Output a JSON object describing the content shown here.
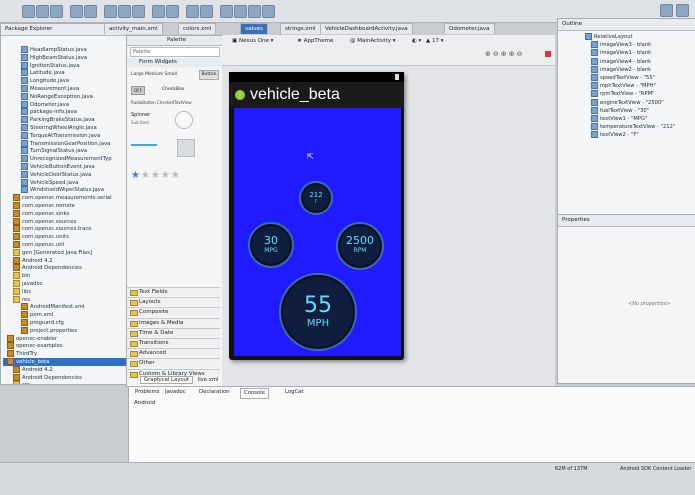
{
  "editor_tabs": [
    {
      "label": "activity_main.xml",
      "active": false
    },
    {
      "label": "colors.xml",
      "active": false
    },
    {
      "label": "values",
      "active": true
    },
    {
      "label": "strings.xml",
      "active": false
    },
    {
      "label": "VehicleDashboardActivity.java",
      "active": false
    },
    {
      "label": "Odometer.java",
      "active": false
    }
  ],
  "explorer": {
    "title": "Package Explorer",
    "items": [
      {
        "label": "HeadlampStatus.java",
        "icon": "java-file-icon"
      },
      {
        "label": "HighBeamStatus.java",
        "icon": "java-file-icon"
      },
      {
        "label": "IgnitionStatus.java",
        "icon": "java-file-icon"
      },
      {
        "label": "Latitude.java",
        "icon": "java-file-icon"
      },
      {
        "label": "Longitude.java",
        "icon": "java-file-icon"
      },
      {
        "label": "Measurement.java",
        "icon": "java-file-icon"
      },
      {
        "label": "NoRangeException.java",
        "icon": "java-file-icon"
      },
      {
        "label": "Odometer.java",
        "icon": "java-file-icon"
      },
      {
        "label": "package-info.java",
        "icon": "java-file-icon"
      },
      {
        "label": "ParkingBrakeStatus.java",
        "icon": "java-file-icon"
      },
      {
        "label": "SteeringWheelAngle.java",
        "icon": "java-file-icon"
      },
      {
        "label": "TorqueAtTransmission.java",
        "icon": "java-file-icon"
      },
      {
        "label": "TransmissionGearPosition.java",
        "icon": "java-file-icon"
      },
      {
        "label": "TurnSignalStatus.java",
        "icon": "java-file-icon"
      },
      {
        "label": "UnrecognizedMeasurementTyp",
        "icon": "java-file-icon"
      },
      {
        "label": "VehicleButtonEvent.java",
        "icon": "java-file-icon"
      },
      {
        "label": "VehicleDoorStatus.java",
        "icon": "java-file-icon"
      },
      {
        "label": "VehicleSpeed.java",
        "icon": "java-file-icon"
      },
      {
        "label": "WindshieldWiperStatus.java",
        "icon": "java-file-icon"
      },
      {
        "label": "com.openxc.measurements.serial",
        "icon": "package-icon"
      },
      {
        "label": "com.openxc.remote",
        "icon": "package-icon"
      },
      {
        "label": "com.openxc.sinks",
        "icon": "package-icon"
      },
      {
        "label": "com.openxc.sources",
        "icon": "package-icon"
      },
      {
        "label": "com.openxc.sources.trace",
        "icon": "package-icon"
      },
      {
        "label": "com.openxc.units",
        "icon": "package-icon"
      },
      {
        "label": "com.openxc.util",
        "icon": "package-icon"
      },
      {
        "label": "gen [Generated Java Files]",
        "icon": "folder-icon"
      },
      {
        "label": "Android 4.2",
        "icon": "library-icon"
      },
      {
        "label": "Android Dependencies",
        "icon": "library-icon"
      },
      {
        "label": "bin",
        "icon": "folder-icon"
      },
      {
        "label": "javadoc",
        "icon": "folder-icon"
      },
      {
        "label": "libs",
        "icon": "folder-icon"
      },
      {
        "label": "res",
        "icon": "folder-icon"
      },
      {
        "label": "AndroidManifest.xml",
        "icon": "xml-file-icon"
      },
      {
        "label": "pom.xml",
        "icon": "xml-file-icon"
      },
      {
        "label": "proguard.cfg",
        "icon": "file-icon"
      },
      {
        "label": "project.properties",
        "icon": "file-icon"
      },
      {
        "label": "openxc-enabler",
        "icon": "project-icon"
      },
      {
        "label": "openxc-examples",
        "icon": "project-icon"
      },
      {
        "label": "ThirdTry",
        "icon": "project-icon"
      },
      {
        "label": "vehicle_beta",
        "icon": "project-icon",
        "selected": true
      },
      {
        "label": "Android 4.2",
        "icon": "library-icon"
      },
      {
        "label": "Android Dependencies",
        "icon": "library-icon"
      },
      {
        "label": "src",
        "icon": "folder-icon"
      },
      {
        "label": "gen [Generated Java Files]",
        "icon": "folder-icon"
      },
      {
        "label": "assets",
        "icon": "folder-icon"
      },
      {
        "label": "bin",
        "icon": "folder-icon"
      },
      {
        "label": "libs",
        "icon": "folder-icon"
      },
      {
        "label": "res",
        "icon": "folder-icon"
      },
      {
        "label": "AndroidManifest.xml",
        "icon": "xml-file-icon"
      },
      {
        "label": "ic_launcher-web.png",
        "icon": "image-file-icon"
      },
      {
        "label": "proguard-project.txt",
        "icon": "file-icon"
      }
    ]
  },
  "palette": {
    "title": "Palette",
    "search": "Palette",
    "open_section": "Form Widgets",
    "widget_labels": {
      "text_sizes": "Large  Medium  Small",
      "button": "Button",
      "toggle_off": "OFF",
      "checkbox": "CheckBox",
      "radio": "RadioButton  CheckedTextView",
      "spinner": "Spinner",
      "spinner_sub": "Sub Item"
    },
    "sections": [
      "Text Fields",
      "Layouts",
      "Composite",
      "Images & Media",
      "Time & Date",
      "Transitions",
      "Advanced",
      "Other",
      "Custom & Library Views"
    ]
  },
  "layout_toolbar": {
    "device": "Nexus One",
    "theme": "AppTheme",
    "activity": "MainActivity",
    "api": "17"
  },
  "app_preview": {
    "title": "vehicle_beta",
    "temperature": "212",
    "temperature_unit": "F",
    "fuel": "30",
    "fuel_unit": "MPG",
    "rpm": "2500",
    "rpm_unit": "RPM",
    "speed": "55",
    "speed_unit": "MPH",
    "bg_color": "#1f1aff"
  },
  "editor_bottom_tabs": [
    "Graphical Layout",
    "live.xml"
  ],
  "outline": {
    "title": "Outline",
    "items": [
      {
        "label": "RelativeLayout",
        "depth": 0
      },
      {
        "label": "imageView3 - blank",
        "depth": 1
      },
      {
        "label": "imageView1 - blank",
        "depth": 1
      },
      {
        "label": "imageView4 - blank",
        "depth": 1
      },
      {
        "label": "imageView2 - blank",
        "depth": 1
      },
      {
        "label": "speedTextView - \"55\"",
        "depth": 1
      },
      {
        "label": "mphTextView - \"MPH\"",
        "depth": 1
      },
      {
        "label": "rpmTextView - \"RPM\"",
        "depth": 1
      },
      {
        "label": "engineTextView - \"2500\"",
        "depth": 1
      },
      {
        "label": "fuelTextView - \"30\"",
        "depth": 1
      },
      {
        "label": "textView1 - \"MPG\"",
        "depth": 1
      },
      {
        "label": "temperatureTextView - \"212\"",
        "depth": 1
      },
      {
        "label": "textView2 - \"F\"",
        "depth": 1
      }
    ]
  },
  "properties": {
    "title": "Properties",
    "empty_text": "<No properties>"
  },
  "bottom_tabs": [
    "Problems",
    "Javadoc",
    "Declaration",
    "Console",
    "LogCat"
  ],
  "console_text": "Android",
  "status_bar": {
    "memory": "62M of 137M",
    "loader": "Android SDK Content Loader"
  }
}
